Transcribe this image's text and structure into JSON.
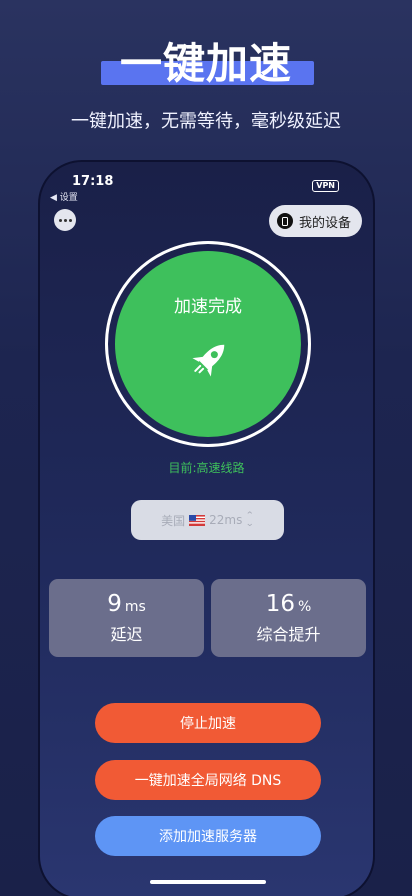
{
  "hero": {
    "title": "一键加速",
    "subtitle": "一键加速，无需等待，毫秒级延迟"
  },
  "status_bar": {
    "time": "17:18",
    "back_label": "◀ 设置",
    "vpn": "VPN"
  },
  "toolbar": {
    "more_icon": "more-dots-icon",
    "device_label": "我的设备",
    "device_icon": "phone-icon"
  },
  "accelerator": {
    "status_text": "加速完成",
    "icon": "rocket-icon",
    "current_line": "目前:高速线路",
    "accent_color": "#3ec05c"
  },
  "region": {
    "country": "美国",
    "flag": "us-flag-icon",
    "latency": "22ms",
    "chevron": "⌃⌄"
  },
  "stats": {
    "latency": {
      "value": "9",
      "unit": "ms",
      "label": "延迟"
    },
    "boost": {
      "value": "16",
      "unit": "%",
      "label": "综合提升"
    }
  },
  "actions": {
    "stop": "停止加速",
    "dns": "一键加速全局网络 DNS",
    "add_server": "添加加速服务器",
    "stop_color": "#f15a35",
    "add_color": "#5e95f5"
  }
}
